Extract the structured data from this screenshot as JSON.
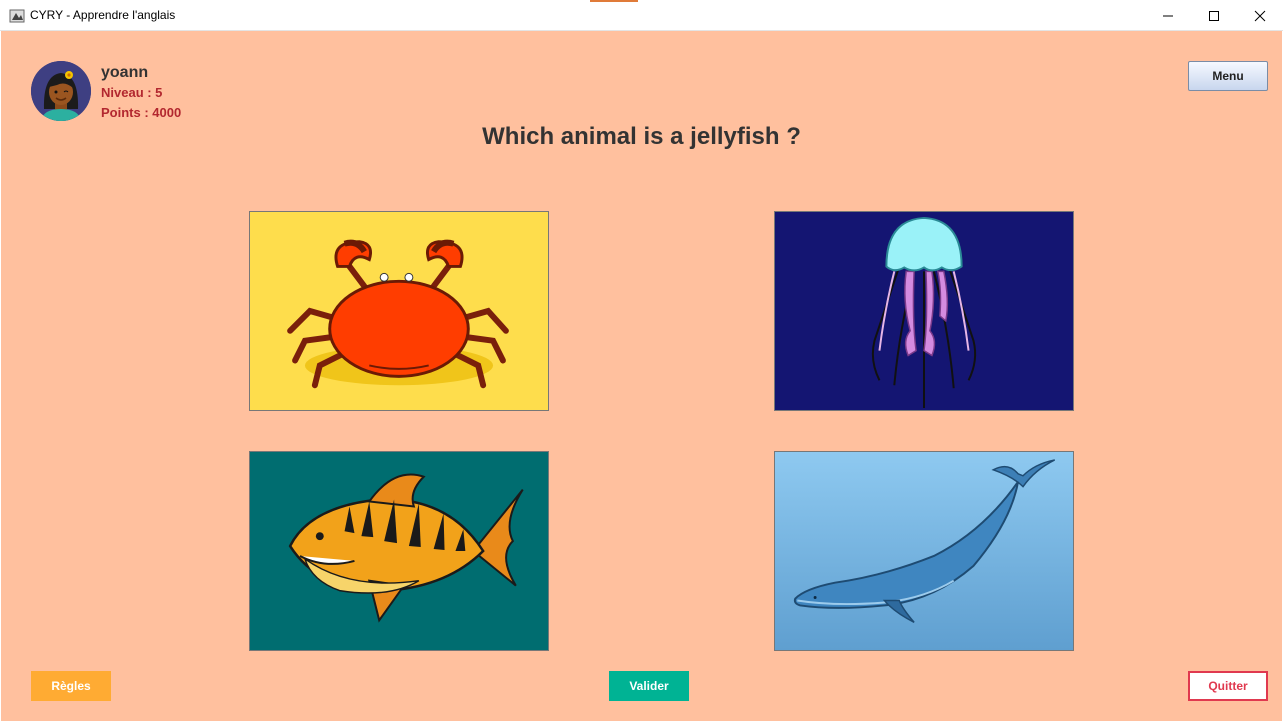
{
  "window": {
    "title": "CYRY - Apprendre l'anglais"
  },
  "user": {
    "name": "yoann",
    "level": "Niveau : 5",
    "points": "Points : 4000"
  },
  "header": {
    "menu_label": "Menu"
  },
  "quiz": {
    "question": "Which animal is a jellyfish ?",
    "choices": [
      {
        "animal": "crab",
        "background": "#fedd4c"
      },
      {
        "animal": "jellyfish",
        "background": "#141572"
      },
      {
        "animal": "shark",
        "background": "#006d70"
      },
      {
        "animal": "whale",
        "background": "#6aaadb"
      }
    ]
  },
  "footer": {
    "rules_label": "Règles",
    "validate_label": "Valider",
    "quit_label": "Quitter"
  },
  "colors": {
    "background": "#ffc09e",
    "accent_red": "#b2272f",
    "rules": "#ffab33",
    "validate": "#00b394",
    "quit": "#e0394f"
  }
}
